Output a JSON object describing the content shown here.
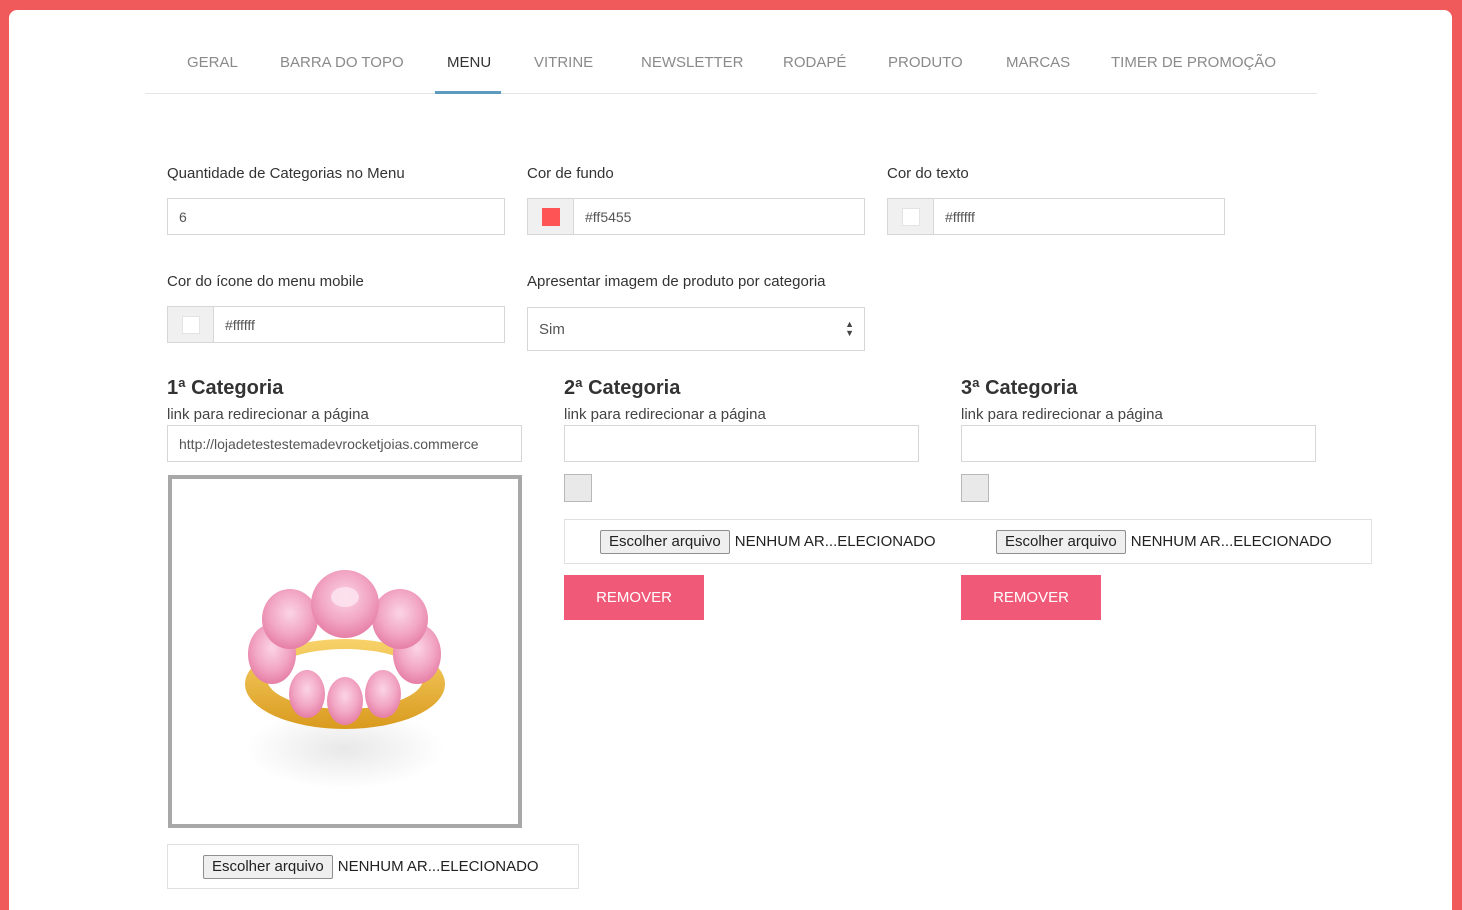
{
  "tabs": [
    {
      "label": "GERAL"
    },
    {
      "label": "BARRA DO TOPO"
    },
    {
      "label": "MENU"
    },
    {
      "label": "VITRINE"
    },
    {
      "label": "NEWSLETTER"
    },
    {
      "label": "RODAPÉ"
    },
    {
      "label": "PRODUTO"
    },
    {
      "label": "MARCAS"
    },
    {
      "label": "TIMER DE PROMOÇÃO"
    }
  ],
  "active_tab": "MENU",
  "form": {
    "qty_label": "Quantidade de Categorias no Menu",
    "qty_value": "6",
    "bg_label": "Cor de fundo",
    "bg_color": "#ff5455",
    "text_label": "Cor do texto",
    "text_color": "#ffffff",
    "mobile_icon_label": "Cor do ícone do menu mobile",
    "mobile_icon_color": "#ffffff",
    "show_image_label": "Apresentar imagem de produto por categoria",
    "show_image_value": "Sim"
  },
  "categories": [
    {
      "title": "1ª Categoria",
      "link_label": "link para redirecionar a página",
      "link_value": "http://lojadetestestemadevrocketjoias.commerce",
      "file_button": "Escolher arquivo",
      "file_name": "NENHUM AR...ELECIONADO"
    },
    {
      "title": "2ª Categoria",
      "link_label": "link para redirecionar a página",
      "link_value": "",
      "file_button": "Escolher arquivo",
      "file_name": "NENHUM AR...ELECIONADO",
      "remove_label": "REMOVER"
    },
    {
      "title": "3ª Categoria",
      "link_label": "link para redirecionar a página",
      "link_value": "",
      "file_button": "Escolher arquivo",
      "file_name": "NENHUM AR...ELECIONADO",
      "remove_label": "REMOVER"
    }
  ],
  "colors": {
    "page_border": "#f05a5a",
    "accent_tab_underline": "#5c9bbd",
    "remove_button": "#f05a78"
  }
}
